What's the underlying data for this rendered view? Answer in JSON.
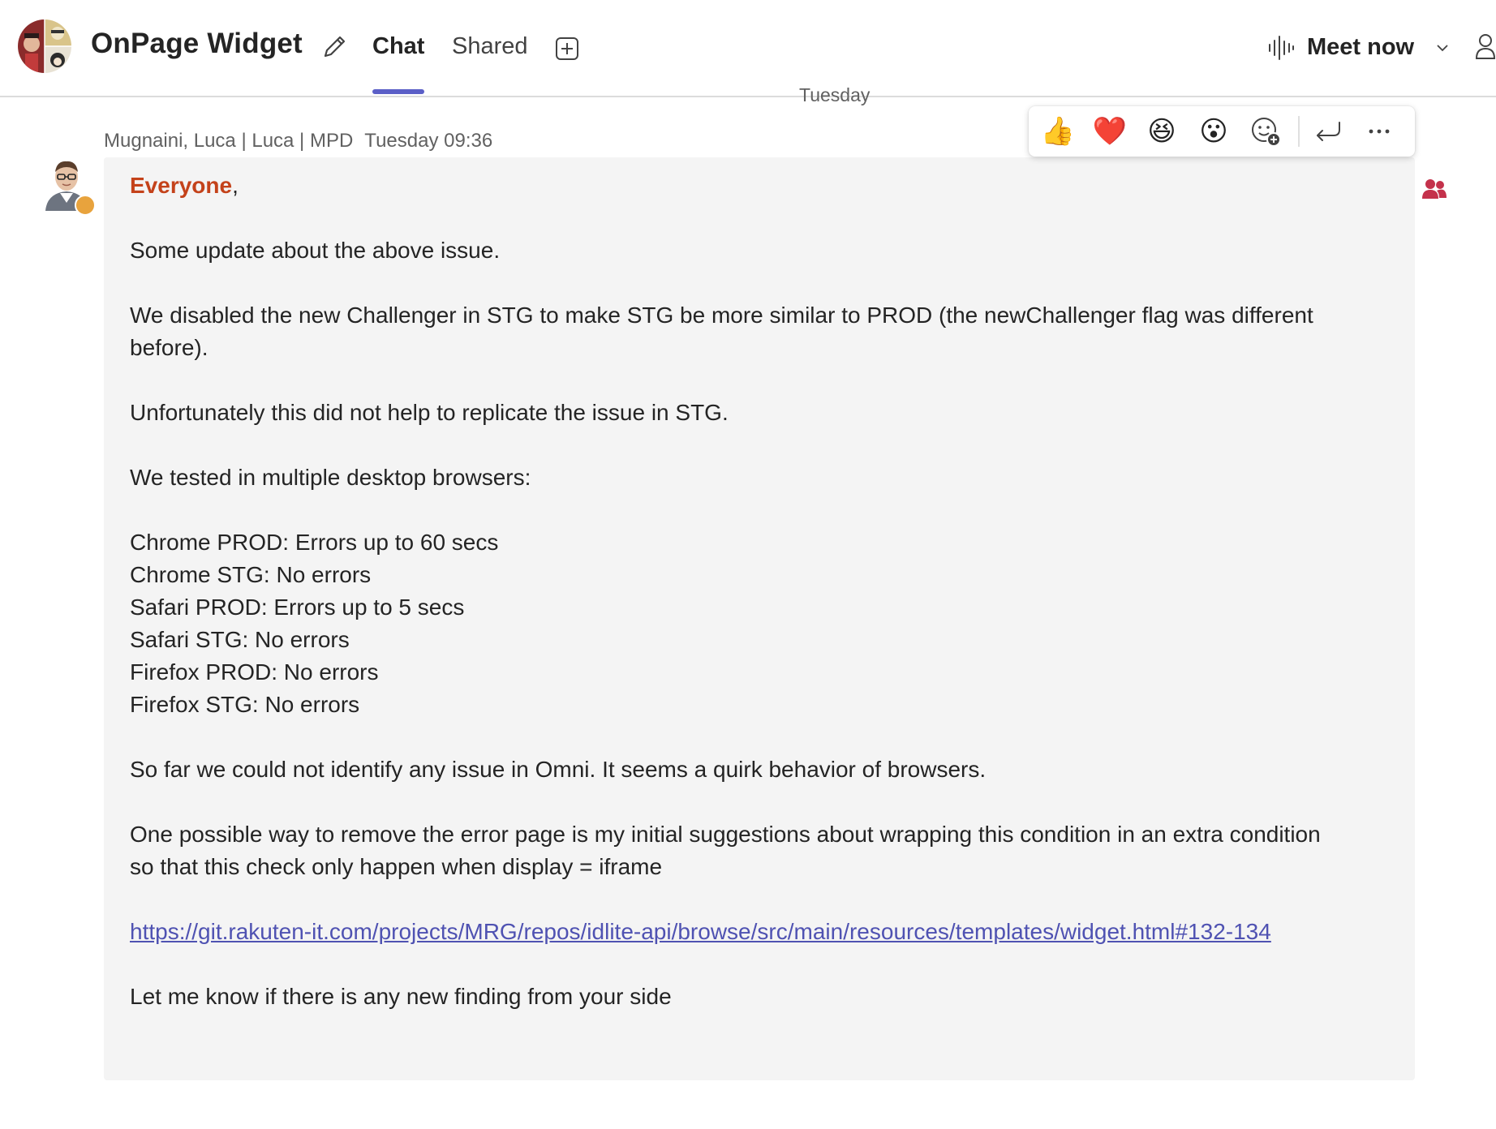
{
  "header": {
    "title": "OnPage Widget",
    "tabs": [
      {
        "label": "Chat",
        "active": true
      },
      {
        "label": "Shared",
        "active": false
      }
    ],
    "meet_label": "Meet now"
  },
  "date_divider": "Tuesday",
  "message": {
    "sender": "Mugnaini, Luca | Luca | MPD",
    "time": "Tuesday 09:36",
    "mention": "Everyone",
    "mention_suffix": ",",
    "lines": [
      "Some update about the above issue.",
      "We disabled the new Challenger in STG to make STG be more similar to PROD (the newChallenger flag was different",
      "before).",
      "Unfortunately this did not help to replicate the issue in STG.",
      "We tested in multiple desktop browsers:",
      "Chrome PROD: Errors up to 60 secs",
      "Chrome STG: No errors",
      "Safari PROD: Errors up to 5 secs",
      "Safari STG: No errors",
      "Firefox PROD: No errors",
      "Firefox STG: No errors",
      "So far we could not identify any issue in Omni. It seems a quirk behavior of browsers.",
      "One possible way to remove the error page is my initial suggestions about wrapping this condition in an extra condition",
      "so that this check only happen when display = iframe",
      "Let me know if there is any new finding from your side"
    ],
    "link": "https://git.rakuten-it.com/projects/MRG/repos/idlite-api/browse/src/main/resources/templates/widget.html#132-134"
  },
  "reactions": {
    "like": "👍",
    "heart": "❤️",
    "laugh": "😆",
    "surprised": "😮",
    "icons": [
      "add-reaction-icon",
      "reply-icon",
      "more-options-icon"
    ]
  },
  "colors": {
    "accent": "#5b5fc7",
    "mention": "#c4421a",
    "link": "#4f52b2",
    "bubble": "#f4f4f4",
    "status_away": "#e8a33d",
    "group_mention": "#c4314b"
  }
}
